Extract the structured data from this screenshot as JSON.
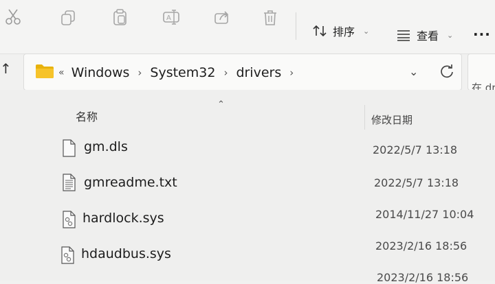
{
  "toolbar": {
    "sort_label": "排序",
    "view_label": "查看",
    "more_label": "···"
  },
  "address": {
    "overflow": "«",
    "crumbs": [
      "Windows",
      "System32",
      "drivers"
    ]
  },
  "search": {
    "placeholder": "在 dr"
  },
  "columns": {
    "name": "名称",
    "date": "修改日期"
  },
  "files": [
    {
      "name": "gm.dls",
      "date": "2022/5/7 13:18",
      "icon": "file-icon"
    },
    {
      "name": "gmreadme.txt",
      "date": "2022/5/7 13:18",
      "icon": "text-file-icon"
    },
    {
      "name": "hardlock.sys",
      "date": "2014/11/27 10:04",
      "icon": "system-file-icon"
    },
    {
      "name": "hdaudbus.sys",
      "date": "2023/2/16 18:56",
      "icon": "system-file-icon"
    },
    {
      "name": "",
      "date": "2023/2/16 18:56",
      "icon": "system-file-icon"
    }
  ]
}
